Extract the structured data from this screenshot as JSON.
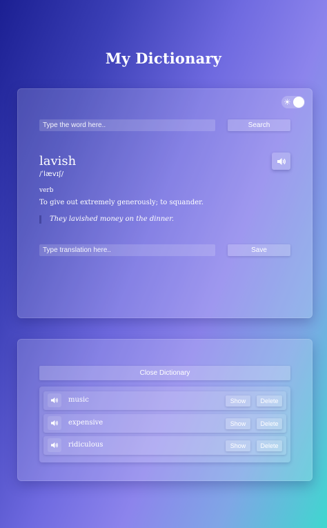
{
  "app": {
    "title": "My Dictionary"
  },
  "theme": {
    "toggle_icon": "sun-icon",
    "toggle_on": true
  },
  "search": {
    "placeholder": "Type the word here..",
    "value": "",
    "button_label": "Search"
  },
  "entry": {
    "word": "lavish",
    "phonetic": "/ˈlævɪʃ/",
    "part_of_speech": "verb",
    "definition": "To give out extremely generously; to squander.",
    "example": "They lavished money on the dinner."
  },
  "translation": {
    "placeholder": "Type translation here..",
    "value": "",
    "save_label": "Save"
  },
  "saved": {
    "close_label": "Close Dictionary",
    "items": [
      {
        "word": "music",
        "show_label": "Show",
        "delete_label": "Delete"
      },
      {
        "word": "expensive",
        "show_label": "Show",
        "delete_label": "Delete"
      },
      {
        "word": "ridiculous",
        "show_label": "Show",
        "delete_label": "Delete"
      }
    ]
  }
}
